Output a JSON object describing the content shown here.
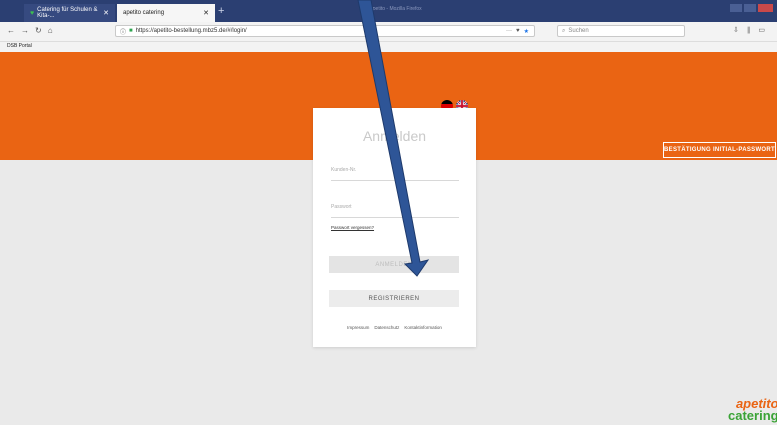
{
  "browser": {
    "tabs": [
      {
        "label": "Catering für Schulen & Kita-..."
      },
      {
        "label": "apetito catering"
      }
    ],
    "window_title": "apetito - Mozilla Firefox",
    "url": "https://apetito-bestellung.mbz5.de/#/login/",
    "search_placeholder": "Suchen",
    "bookmark": "DSB Portal"
  },
  "header": {
    "confirm_button": "BESTÄTIGUNG INITIAL-PASSWORT"
  },
  "login": {
    "title": "Anmelden",
    "customer_no_placeholder": "Kunden-Nr.",
    "password_placeholder": "Passwort",
    "forgot_link": "Passwort vergessen?",
    "login_button": "ANMELDEN",
    "register_button": "REGISTRIEREN",
    "footer_links": [
      "Impressum",
      "Datenschutz",
      "Kontaktinformation"
    ]
  },
  "logo": {
    "line1": "apetito",
    "line2": "catering"
  },
  "colors": {
    "brand_orange": "#ea6413",
    "brand_green": "#3aa336",
    "arrow_blue": "#2e5597"
  }
}
